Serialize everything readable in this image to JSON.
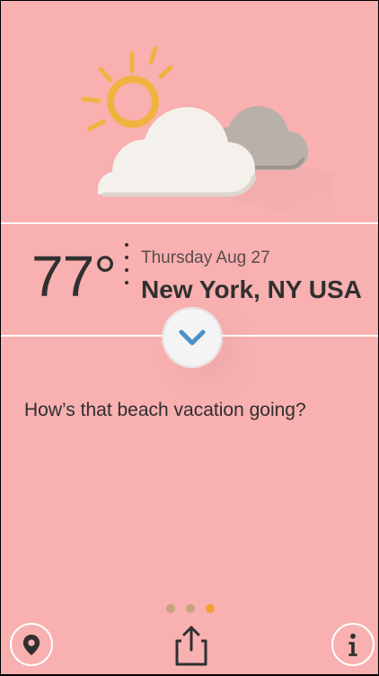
{
  "colors": {
    "background": "#f8b0b0",
    "sun": "#f0b340",
    "cloud_front": "#f4f1ec",
    "cloud_back": "#b8b0a9",
    "accent_blue": "#4c91c8",
    "page_dot_inactive": "#c3a27f",
    "page_dot_active": "#f0a030",
    "text_dark": "#303030"
  },
  "weather": {
    "icon": "partly-cloudy-icon",
    "temperature": "77°",
    "date": "Thursday Aug 27",
    "location": "New York, NY USA",
    "message": "How’s that beach vacation going?"
  },
  "controls": {
    "expand_icon": "chevron-down-icon",
    "location_icon": "location-pin-icon",
    "share_icon": "share-icon",
    "info_icon": "info-icon"
  },
  "pager": {
    "total": 3,
    "active_index": 2
  }
}
